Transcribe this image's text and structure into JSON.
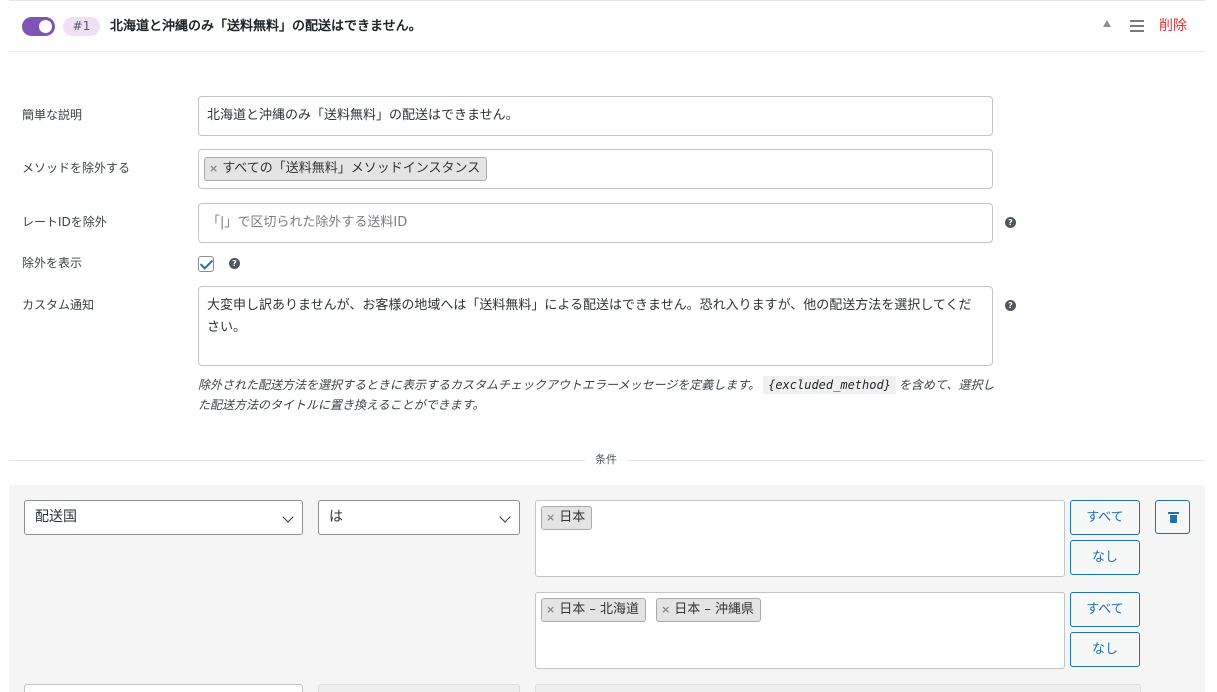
{
  "rule": {
    "number": "#1",
    "title": "北海道と沖縄のみ「送料無料」の配送はできません。",
    "delete_label": "削除",
    "enabled": true
  },
  "form": {
    "description_label": "簡単な説明",
    "description_value": "北海道と沖縄のみ「送料無料」の配送はできません。",
    "exclude_methods_label": "メソッドを除外する",
    "exclude_methods_tags": [
      "すべての「送料無料」メソッドインスタンス"
    ],
    "exclude_rate_ids_label": "レートIDを除外",
    "exclude_rate_ids_placeholder": "「|」で区切られた除外する送料ID",
    "show_exclusion_label": "除外を表示",
    "show_exclusion_checked": true,
    "custom_notice_label": "カスタム通知",
    "custom_notice_value": "大変申し訳ありませんが、お客様の地域へは「送料無料」による配送はできません。恐れ入りますが、他の配送方法を選択してください。",
    "note_before": "除外された配送方法を選択するときに表示するカスタムチェックアウトエラーメッセージを定義します。",
    "note_code": "{excluded_method}",
    "note_after": "を含めて、選択した配送方法のタイトルに置き換えることができます。"
  },
  "conditions": {
    "divider_label": "条件",
    "field_select": "配送国",
    "operator_select": "は",
    "countries": [
      "日本"
    ],
    "regions": [
      "日本 – 北海道",
      "日本 – 沖縄県"
    ],
    "all_label": "すべて",
    "none_label": "なし"
  },
  "icons": {
    "help": "help-icon",
    "remove": "remove-tag-icon",
    "trash": "trash-icon",
    "menu": "menu-icon",
    "sort": "sort-up-icon"
  },
  "colors": {
    "accent": "#7f54b3",
    "link": "#2271b1",
    "danger": "#d63638"
  }
}
